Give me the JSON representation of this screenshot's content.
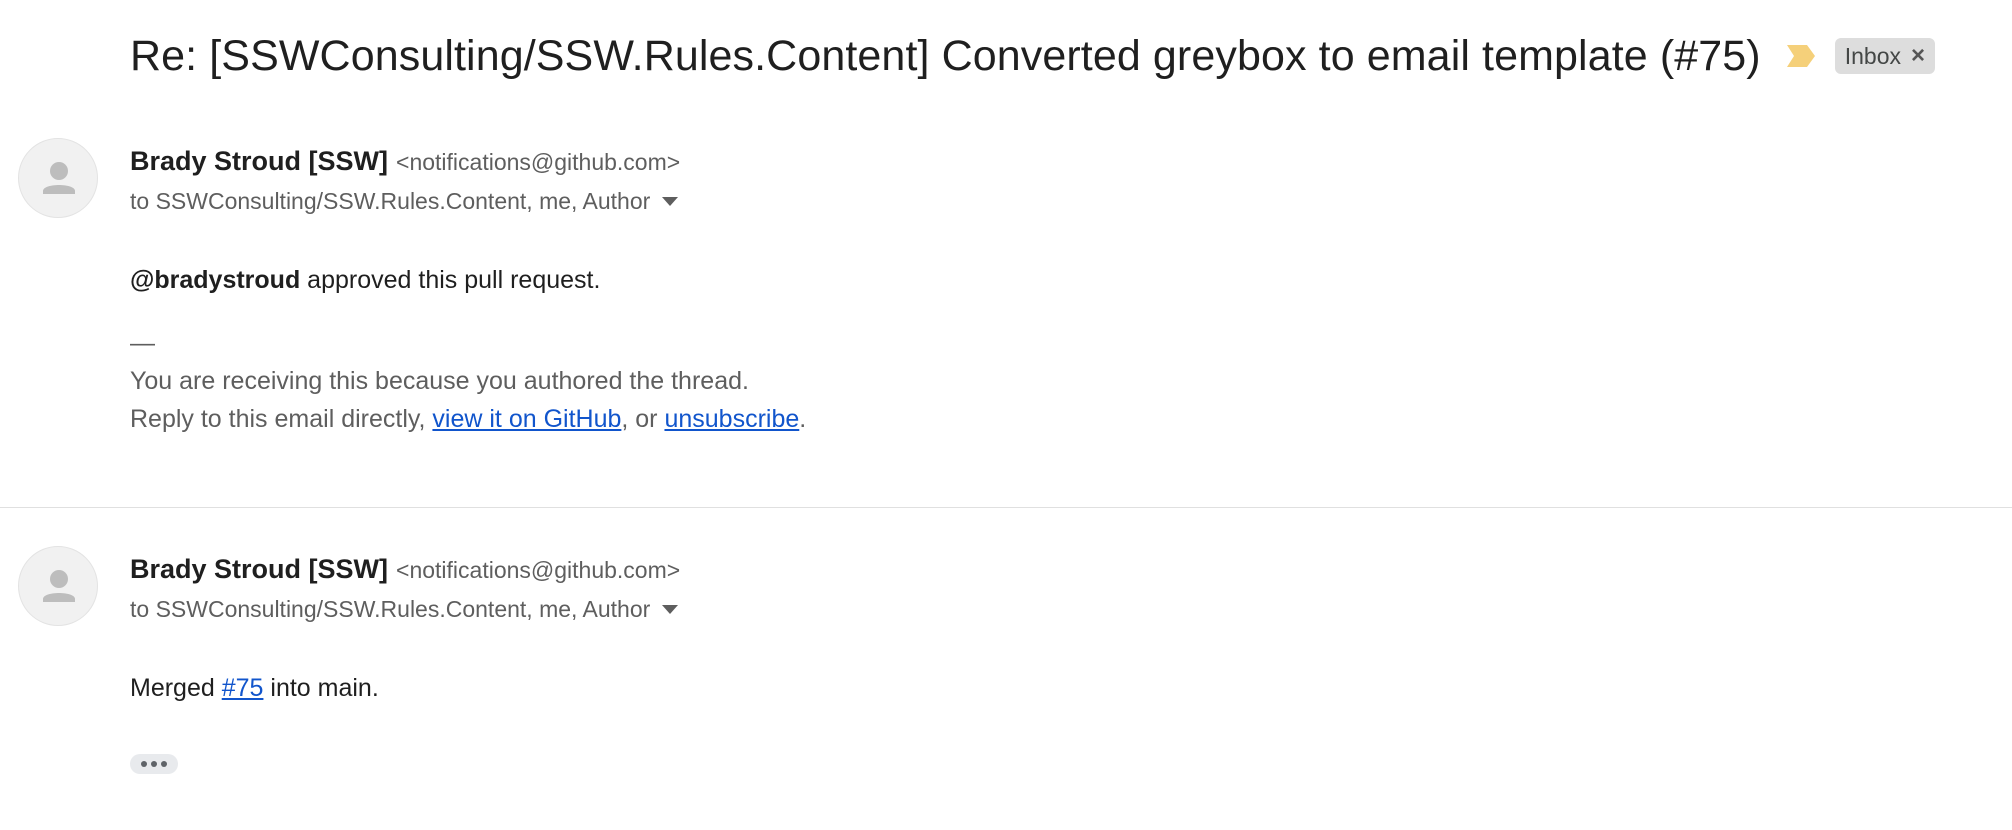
{
  "subject": {
    "text": "Re: [SSWConsulting/SSW.Rules.Content] Converted greybox to email template (#75)",
    "important_marker_icon": "important-marker-icon",
    "important_marker_color": "#f5d07a",
    "label": "Inbox",
    "label_remove": "×"
  },
  "messages": [
    {
      "avatar_icon": "person-icon",
      "sender_name": "Brady Stroud [SSW]",
      "sender_email": "<notifications@github.com>",
      "recipients": "to SSWConsulting/SSW.Rules.Content, me, Author",
      "body_mention": "@bradystroud",
      "body_rest": " approved this pull request.",
      "footer_dash": "—",
      "footer_line1": "You are receiving this because you authored the thread.",
      "footer_line2_prefix": "Reply to this email directly, ",
      "footer_link_github": "view it on GitHub",
      "footer_line2_mid": ", or ",
      "footer_link_unsubscribe": "unsubscribe",
      "footer_line2_suffix": "."
    },
    {
      "avatar_icon": "person-icon",
      "sender_name": "Brady Stroud [SSW]",
      "sender_email": "<notifications@github.com>",
      "recipients": "to SSWConsulting/SSW.Rules.Content, me, Author",
      "body_prefix": "Merged ",
      "body_link": "#75",
      "body_suffix": " into main.",
      "show_trimmed_icon": "more-horizontal-icon"
    }
  ],
  "colors": {
    "link": "#1155cc",
    "secondary_text": "#5e5e5e",
    "chip_bg": "#dddddd"
  }
}
